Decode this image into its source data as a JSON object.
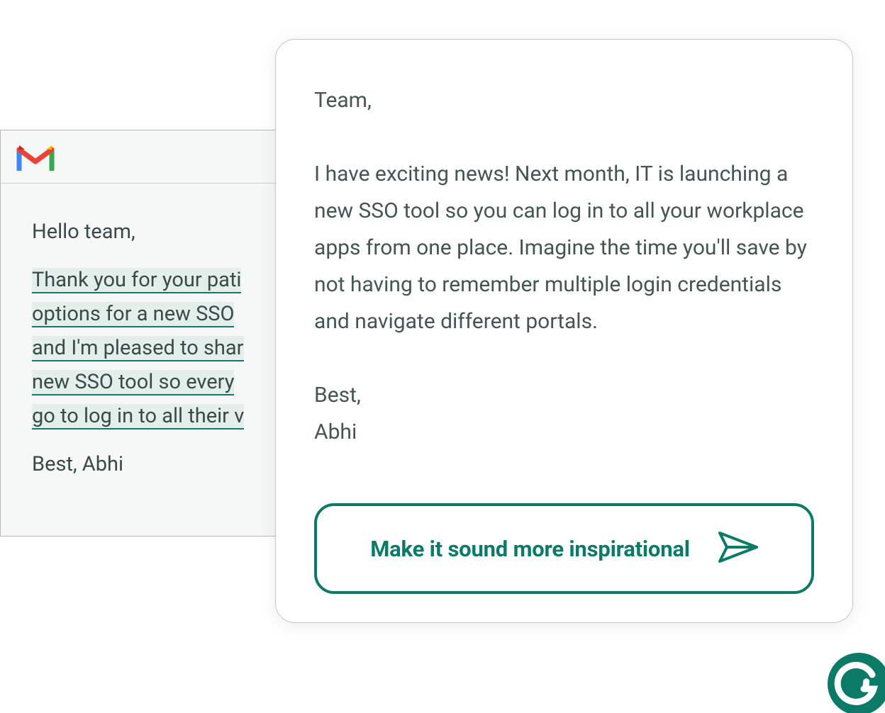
{
  "gmail": {
    "greeting": "Hello team,",
    "highlighted_lines": [
      "Thank you for your pati",
      "options for a new SSO ",
      "and I'm pleased to shar",
      "new SSO tool so every",
      "go to log in to all their v"
    ],
    "signoff": "Best, Abhi"
  },
  "suggestion": {
    "greeting": "Team,",
    "body": "I have exciting news! Next month, IT is launching a new SSO tool so you can log in to all your workplace apps from one place. Imagine the time you'll save by not having to remember multiple login credentials and navigate different portals.",
    "closing": "Best,",
    "signature": "Abhi",
    "action_label": "Make it sound more inspirational"
  },
  "icons": {
    "gmail": "gmail-logo",
    "send": "send-icon",
    "grammarly": "grammarly-badge"
  },
  "colors": {
    "accent": "#0b7a67",
    "highlight_bg": "#e4efec",
    "text": "#445553"
  }
}
